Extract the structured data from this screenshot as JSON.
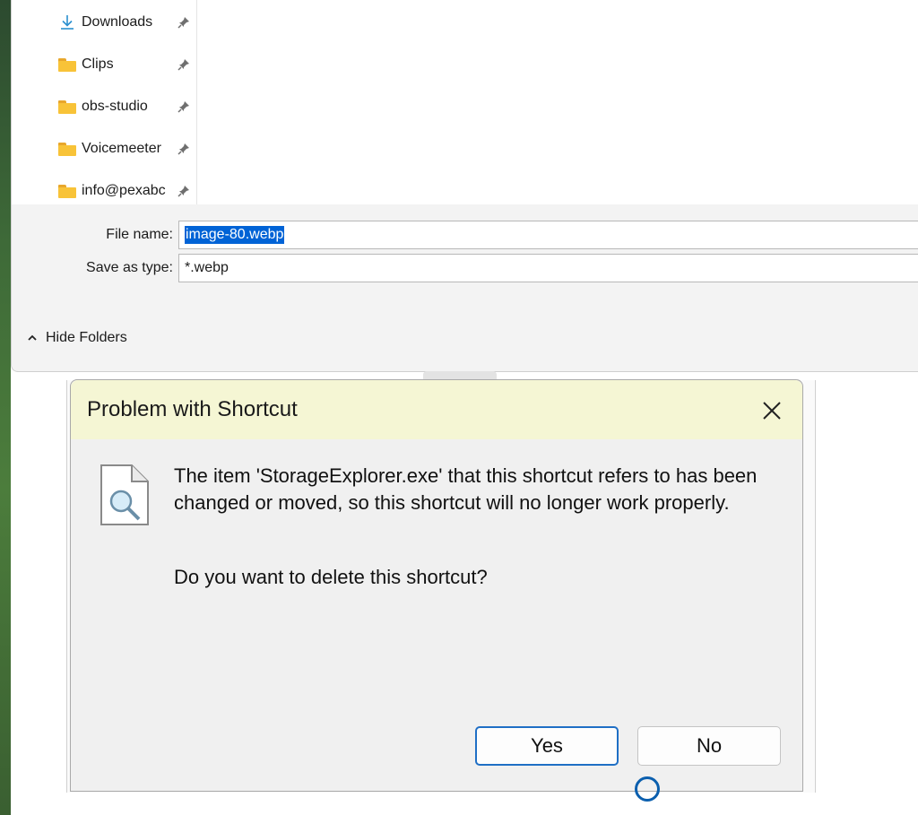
{
  "nav_pane": {
    "items": [
      {
        "label": "Downloads",
        "icon": "download-arrow-icon",
        "pinned": true
      },
      {
        "label": "Clips",
        "icon": "folder-icon",
        "pinned": true
      },
      {
        "label": "obs-studio",
        "icon": "folder-icon",
        "pinned": true
      },
      {
        "label": "Voicemeeter",
        "icon": "folder-icon",
        "pinned": true
      },
      {
        "label": "info@pexabc",
        "icon": "folder-icon",
        "pinned": true
      }
    ]
  },
  "save_form": {
    "file_name_label": "File name:",
    "file_name_value": "image-80.webp",
    "save_type_label": "Save as type:",
    "save_type_value": "*.webp"
  },
  "hide_folders_label": "Hide Folders",
  "message_box": {
    "title": "Problem with Shortcut",
    "body": "The item 'StorageExplorer.exe' that this shortcut refers to has been changed or moved, so this shortcut will no longer work properly.",
    "question": "Do you want to delete this shortcut?",
    "yes_label": "Yes",
    "no_label": "No"
  },
  "colors": {
    "titlebar_bg": "#f5f6d4",
    "selection": "#0063d6",
    "default_button_border": "#1f6fc5",
    "folder": "#f8c338"
  }
}
